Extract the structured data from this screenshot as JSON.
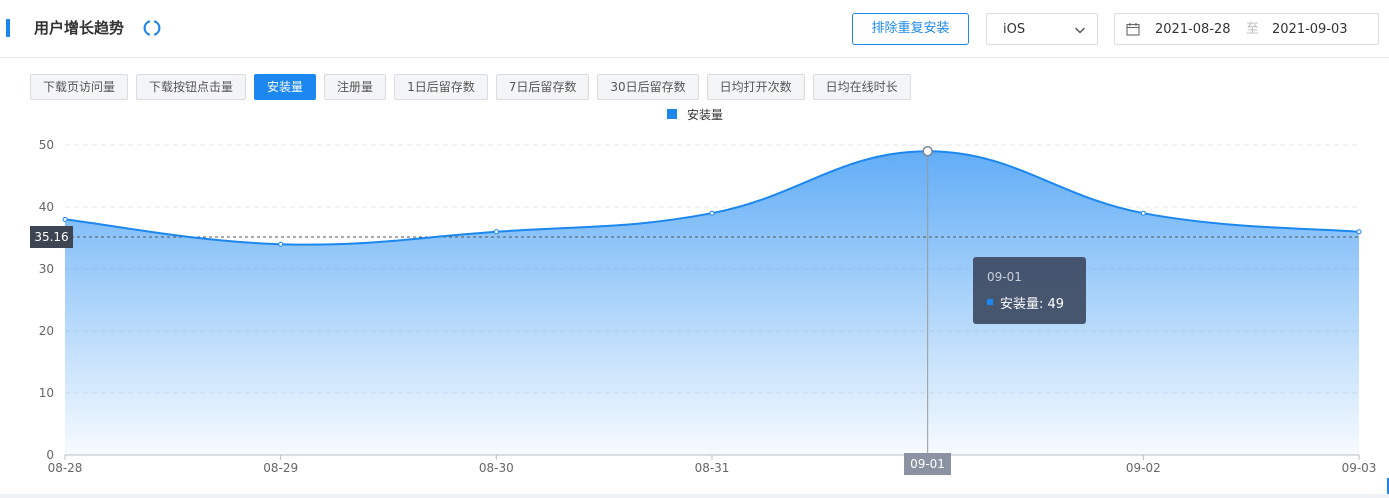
{
  "header": {
    "title": "用户增长趋势",
    "dedup_button": "排除重复安装",
    "platform_select": "iOS",
    "date_start": "2021-08-28",
    "date_separator": "至",
    "date_end": "2021-09-03"
  },
  "tabs": [
    {
      "label": "下载页访问量",
      "active": false
    },
    {
      "label": "下载按钮点击量",
      "active": false
    },
    {
      "label": "安装量",
      "active": true
    },
    {
      "label": "注册量",
      "active": false
    },
    {
      "label": "1日后留存数",
      "active": false
    },
    {
      "label": "7日后留存数",
      "active": false
    },
    {
      "label": "30日后留存数",
      "active": false
    },
    {
      "label": "日均打开次数",
      "active": false
    },
    {
      "label": "日均在线时长",
      "active": false
    }
  ],
  "colors": {
    "accent": "#1c87ee"
  },
  "chart_data": {
    "type": "area",
    "categories": [
      "08-28",
      "08-29",
      "08-30",
      "08-31",
      "09-01",
      "09-02",
      "09-03"
    ],
    "series": [
      {
        "name": "安装量",
        "values": [
          38,
          34,
          36,
          39,
          49,
          39,
          36
        ]
      }
    ],
    "ylim": [
      0,
      50
    ],
    "yticks": [
      0,
      10,
      20,
      30,
      40,
      50
    ],
    "grid": true,
    "legend": "top-center",
    "pointer": {
      "y_value": "35.16",
      "x_value": "09-01"
    },
    "tooltip": {
      "date": "09-01",
      "series": "安装量",
      "value": "49",
      "text": "安装量:  49"
    }
  }
}
